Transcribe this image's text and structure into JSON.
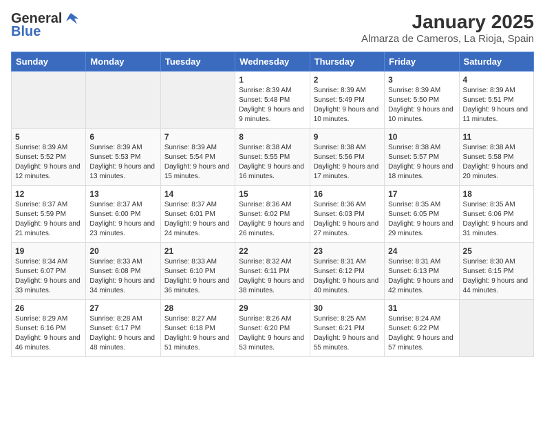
{
  "header": {
    "logo_general": "General",
    "logo_blue": "Blue",
    "title": "January 2025",
    "subtitle": "Almarza de Cameros, La Rioja, Spain"
  },
  "calendar": {
    "days_of_week": [
      "Sunday",
      "Monday",
      "Tuesday",
      "Wednesday",
      "Thursday",
      "Friday",
      "Saturday"
    ],
    "weeks": [
      [
        {
          "day": "",
          "info": ""
        },
        {
          "day": "",
          "info": ""
        },
        {
          "day": "",
          "info": ""
        },
        {
          "day": "1",
          "info": "Sunrise: 8:39 AM\nSunset: 5:48 PM\nDaylight: 9 hours and 9 minutes."
        },
        {
          "day": "2",
          "info": "Sunrise: 8:39 AM\nSunset: 5:49 PM\nDaylight: 9 hours and 10 minutes."
        },
        {
          "day": "3",
          "info": "Sunrise: 8:39 AM\nSunset: 5:50 PM\nDaylight: 9 hours and 10 minutes."
        },
        {
          "day": "4",
          "info": "Sunrise: 8:39 AM\nSunset: 5:51 PM\nDaylight: 9 hours and 11 minutes."
        }
      ],
      [
        {
          "day": "5",
          "info": "Sunrise: 8:39 AM\nSunset: 5:52 PM\nDaylight: 9 hours and 12 minutes."
        },
        {
          "day": "6",
          "info": "Sunrise: 8:39 AM\nSunset: 5:53 PM\nDaylight: 9 hours and 13 minutes."
        },
        {
          "day": "7",
          "info": "Sunrise: 8:39 AM\nSunset: 5:54 PM\nDaylight: 9 hours and 15 minutes."
        },
        {
          "day": "8",
          "info": "Sunrise: 8:38 AM\nSunset: 5:55 PM\nDaylight: 9 hours and 16 minutes."
        },
        {
          "day": "9",
          "info": "Sunrise: 8:38 AM\nSunset: 5:56 PM\nDaylight: 9 hours and 17 minutes."
        },
        {
          "day": "10",
          "info": "Sunrise: 8:38 AM\nSunset: 5:57 PM\nDaylight: 9 hours and 18 minutes."
        },
        {
          "day": "11",
          "info": "Sunrise: 8:38 AM\nSunset: 5:58 PM\nDaylight: 9 hours and 20 minutes."
        }
      ],
      [
        {
          "day": "12",
          "info": "Sunrise: 8:37 AM\nSunset: 5:59 PM\nDaylight: 9 hours and 21 minutes."
        },
        {
          "day": "13",
          "info": "Sunrise: 8:37 AM\nSunset: 6:00 PM\nDaylight: 9 hours and 23 minutes."
        },
        {
          "day": "14",
          "info": "Sunrise: 8:37 AM\nSunset: 6:01 PM\nDaylight: 9 hours and 24 minutes."
        },
        {
          "day": "15",
          "info": "Sunrise: 8:36 AM\nSunset: 6:02 PM\nDaylight: 9 hours and 26 minutes."
        },
        {
          "day": "16",
          "info": "Sunrise: 8:36 AM\nSunset: 6:03 PM\nDaylight: 9 hours and 27 minutes."
        },
        {
          "day": "17",
          "info": "Sunrise: 8:35 AM\nSunset: 6:05 PM\nDaylight: 9 hours and 29 minutes."
        },
        {
          "day": "18",
          "info": "Sunrise: 8:35 AM\nSunset: 6:06 PM\nDaylight: 9 hours and 31 minutes."
        }
      ],
      [
        {
          "day": "19",
          "info": "Sunrise: 8:34 AM\nSunset: 6:07 PM\nDaylight: 9 hours and 33 minutes."
        },
        {
          "day": "20",
          "info": "Sunrise: 8:33 AM\nSunset: 6:08 PM\nDaylight: 9 hours and 34 minutes."
        },
        {
          "day": "21",
          "info": "Sunrise: 8:33 AM\nSunset: 6:10 PM\nDaylight: 9 hours and 36 minutes."
        },
        {
          "day": "22",
          "info": "Sunrise: 8:32 AM\nSunset: 6:11 PM\nDaylight: 9 hours and 38 minutes."
        },
        {
          "day": "23",
          "info": "Sunrise: 8:31 AM\nSunset: 6:12 PM\nDaylight: 9 hours and 40 minutes."
        },
        {
          "day": "24",
          "info": "Sunrise: 8:31 AM\nSunset: 6:13 PM\nDaylight: 9 hours and 42 minutes."
        },
        {
          "day": "25",
          "info": "Sunrise: 8:30 AM\nSunset: 6:15 PM\nDaylight: 9 hours and 44 minutes."
        }
      ],
      [
        {
          "day": "26",
          "info": "Sunrise: 8:29 AM\nSunset: 6:16 PM\nDaylight: 9 hours and 46 minutes."
        },
        {
          "day": "27",
          "info": "Sunrise: 8:28 AM\nSunset: 6:17 PM\nDaylight: 9 hours and 48 minutes."
        },
        {
          "day": "28",
          "info": "Sunrise: 8:27 AM\nSunset: 6:18 PM\nDaylight: 9 hours and 51 minutes."
        },
        {
          "day": "29",
          "info": "Sunrise: 8:26 AM\nSunset: 6:20 PM\nDaylight: 9 hours and 53 minutes."
        },
        {
          "day": "30",
          "info": "Sunrise: 8:25 AM\nSunset: 6:21 PM\nDaylight: 9 hours and 55 minutes."
        },
        {
          "day": "31",
          "info": "Sunrise: 8:24 AM\nSunset: 6:22 PM\nDaylight: 9 hours and 57 minutes."
        },
        {
          "day": "",
          "info": ""
        }
      ]
    ]
  }
}
